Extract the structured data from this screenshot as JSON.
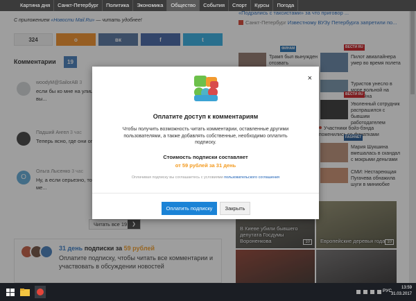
{
  "nav": {
    "items": [
      "Картина дня",
      "Санкт-Петербург",
      "Политика",
      "Экономика",
      "Общество",
      "События",
      "Спорт",
      "Курсы",
      "Погода"
    ],
    "active": "Общество"
  },
  "promo": {
    "prefix": "С приложением ",
    "link": "«Новости Mail.Ru»",
    "suffix": " — читать удобнее!"
  },
  "share": {
    "count": "324",
    "ok": "о",
    "vk": "вк",
    "fb": "f",
    "tw": "t"
  },
  "comments_section": {
    "title": "Комментарии",
    "count": "19",
    "items": [
      {
        "author": "woodyM@SailorAB",
        "time": "3",
        "text": "если бы ко мне на улице ... вокруг чего вращается ... существем а просто вы..."
      },
      {
        "author": "Падший Ангел",
        "time": "3 час",
        "text": "Теперь ясно, где они опр..."
      },
      {
        "author": "Ольга Лысенко",
        "time": "3 час",
        "text": "Ну, а если серьезно, то с... возраст и место прожив... министре и в каком ме..."
      }
    ],
    "more_label": "Читать все 19",
    "chevron": "❯"
  },
  "subscription_box": {
    "days": "31 день",
    "middle": " подписки за ",
    "price": "59 рублей",
    "text": "Оплатите подписку, чтобы читать все комментарии и участвовать в обсуждении новостей"
  },
  "right": {
    "top_news": [
      {
        "text": "«Подрались с таксистами» за что приговор ...",
        "city": "",
        "head": ""
      },
      {
        "city": "Санкт-Петербург",
        "head": "Известному ВУЗу Петербурга запретили по..."
      }
    ],
    "tiles": [
      {
        "caption": "Трамп был вынужден отозвать законопроект об отмене Obamacare",
        "source": "ФИНАМ"
      },
      {
        "caption": "Пилот авиалайнера умер во время полета",
        "source": "ВЕСТИ RU"
      },
      {
        "caption": "Туристов унесло в море вольной на бассейна",
        "source": ""
      },
      {
        "caption": "Уволенный сотрудник распрашился с бывшим работодателем",
        "source": "ВЕСТИ RU"
      },
      {
        "caption": "Участники бойз-бэнда поженились со фанатками",
        "source": ""
      },
      {
        "caption": "Мария Шукшина вмешалась в скандал с мокрыми деньгами",
        "source": "FASHNET"
      },
      {
        "caption": "СМИ: Нестареющая Пугачева обнажила шуги в миниюбке",
        "source": ""
      }
    ],
    "bullets": [
      "Участники бойз-бэнда",
      "поженились со фанатками"
    ],
    "big_images": [
      {
        "caption": "В Киеве убили бывшего депутата Госдумы Вороненкова",
        "num": "10"
      },
      {
        "caption": "Европейские деревья года",
        "num": "10"
      }
    ]
  },
  "modal": {
    "title": "Оплатите доступ к комментариям",
    "description": "Чтобы получить возможность читать комментарии, оставленные другими пользователями, а также добавлять собственные, необходимо оплатить подписку.",
    "price_label": "Стоимость подписки составляет",
    "price_value": "от 59 рублей за 31 день",
    "terms_prefix": "Оплачивая подписку вы соглашаетесь с условиями ",
    "terms_link": "пользовательского соглашения",
    "pay_button": "Оплатить подписку",
    "close_button": "Закрыть",
    "close_icon": "×"
  },
  "taskbar": {
    "lang": "РУС",
    "time": "13:59",
    "date": "31.03.2017"
  },
  "colors": {
    "accent_blue": "#1b83d6",
    "orange": "#f39a1f",
    "nav_bg": "#3b3b3b"
  }
}
